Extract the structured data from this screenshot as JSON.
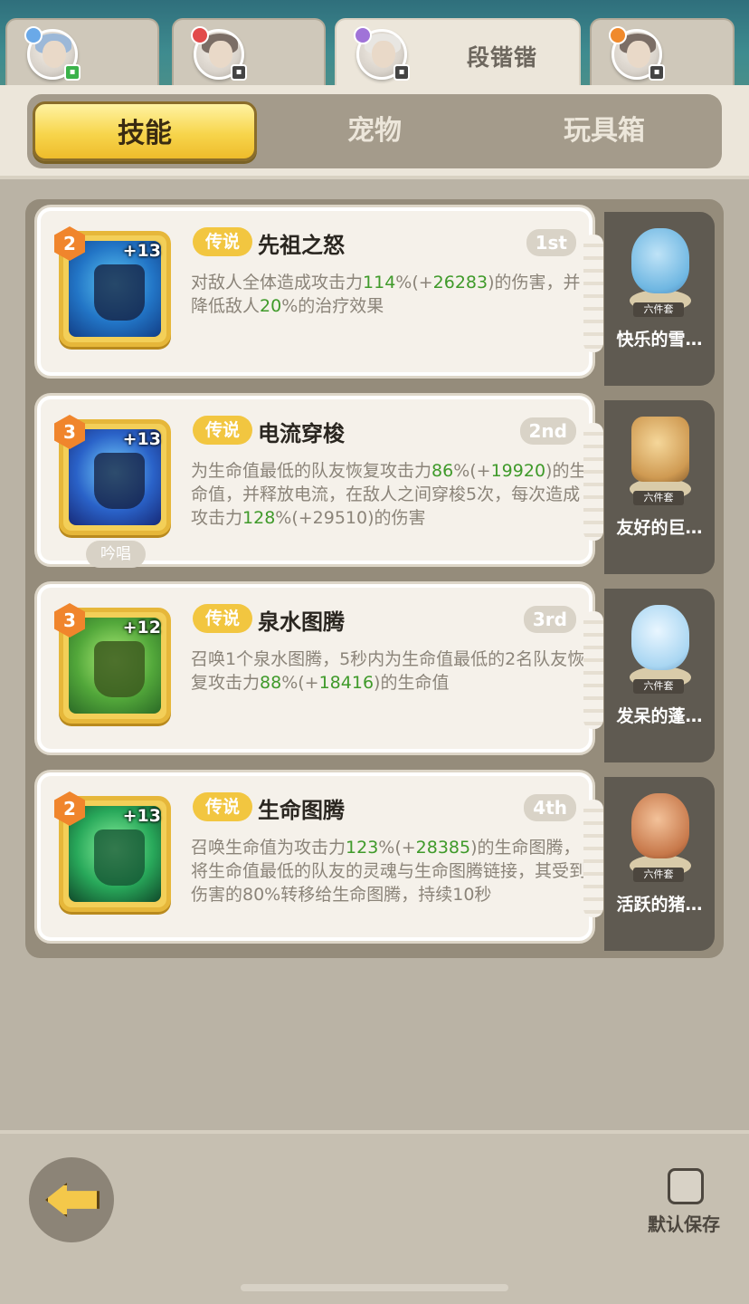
{
  "heroes": [
    {
      "name": "",
      "class_color": "#6aa9e8",
      "status_icon": "chat-icon",
      "status_color": "#3bb24a"
    },
    {
      "name": "",
      "class_color": "#e24b4b",
      "status_icon": "controller-icon",
      "status_color": "#444444"
    },
    {
      "name": "段锴锴",
      "class_color": "#a073d8",
      "status_icon": "controller-icon",
      "status_color": "#444444",
      "active": true
    },
    {
      "name": "",
      "class_color": "#f08a2c",
      "status_icon": "controller-icon",
      "status_color": "#444444"
    }
  ],
  "categories": [
    {
      "label": "技能",
      "active": true
    },
    {
      "label": "宠物",
      "active": false
    },
    {
      "label": "玩具箱",
      "active": false
    }
  ],
  "skills": [
    {
      "level": "2",
      "plus": "+13",
      "rarity": "传说",
      "name": "先祖之怒",
      "order": "1st",
      "desc": {
        "a": "对敌人全体造成攻击力",
        "b": "114",
        "c": "%(+",
        "d": "26283",
        "e": ")的伤害，并降低敌人",
        "f": "20",
        "g": "%的治疗效果"
      },
      "chant": "",
      "pet": {
        "tag": "六件套",
        "name": "快乐的雪…"
      }
    },
    {
      "level": "3",
      "plus": "+13",
      "rarity": "传说",
      "name": "电流穿梭",
      "order": "2nd",
      "desc": {
        "a": "为生命值最低的队友恢复攻击力",
        "b": "86",
        "c": "%(+",
        "d": "19920",
        "e": ")的生命值，并释放电流，在敌人之间穿梭5次，每次造成攻击力",
        "f": "128",
        "g": "%(+29510)的伤害"
      },
      "chant": "吟唱",
      "pet": {
        "tag": "六件套",
        "name": "友好的巨…"
      }
    },
    {
      "level": "3",
      "plus": "+12",
      "rarity": "传说",
      "name": "泉水图腾",
      "order": "3rd",
      "desc": {
        "a": "召唤1个泉水图腾，5秒内为生命值最低的2名队友恢复攻击力",
        "b": "88",
        "c": "%(+",
        "d": "18416",
        "e": ")的生命值",
        "f": "",
        "g": ""
      },
      "chant": "",
      "pet": {
        "tag": "六件套",
        "name": "发呆的蓬…"
      }
    },
    {
      "level": "2",
      "plus": "+13",
      "rarity": "传说",
      "name": "生命图腾",
      "order": "4th",
      "desc": {
        "a": "召唤生命值为攻击力",
        "b": "123",
        "c": "%(+",
        "d": "28385",
        "e": ")的生命图腾，将生命值最低的队友的灵魂与生命图腾链接，其受到伤害的80%转移给生命图腾，持续10秒",
        "f": "",
        "g": ""
      },
      "chant": "",
      "pet": {
        "tag": "六件套",
        "name": "活跃的猪…"
      }
    }
  ],
  "footer": {
    "save_label": "默认保存"
  },
  "colors": {
    "accent_yellow": "#f7d54c",
    "highlight_green": "#3f9a2a",
    "rarity_gold": "#f2c640"
  }
}
